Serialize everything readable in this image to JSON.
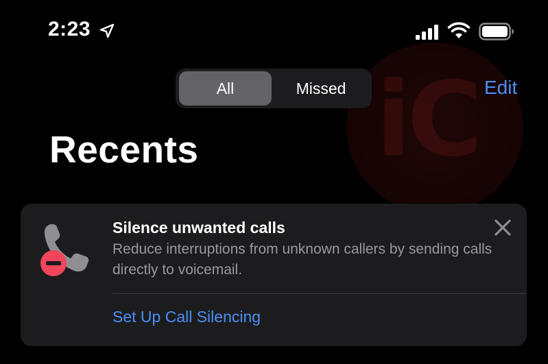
{
  "status_bar": {
    "time": "2:23",
    "icons": [
      "location-arrow-icon",
      "cellular-signal-icon",
      "wifi-icon",
      "battery-icon"
    ]
  },
  "segmented_control": {
    "options": [
      "All",
      "Missed"
    ],
    "selected": "All"
  },
  "header": {
    "edit_label": "Edit",
    "title": "Recents"
  },
  "card": {
    "icon": "phone-silence-icon",
    "title": "Silence unwanted calls",
    "description": "Reduce interruptions from unknown callers by sending calls directly to voicemail.",
    "action_label": "Set Up Call Silencing",
    "close_icon": "close-icon"
  },
  "watermark": {
    "text": "iC"
  },
  "colors": {
    "background": "#000000",
    "card_background": "#1c1c1e",
    "accent_blue": "#4a8ff7",
    "secondary_text": "#98989e",
    "segment_selected": "#636366",
    "badge_red": "#f0455a"
  }
}
